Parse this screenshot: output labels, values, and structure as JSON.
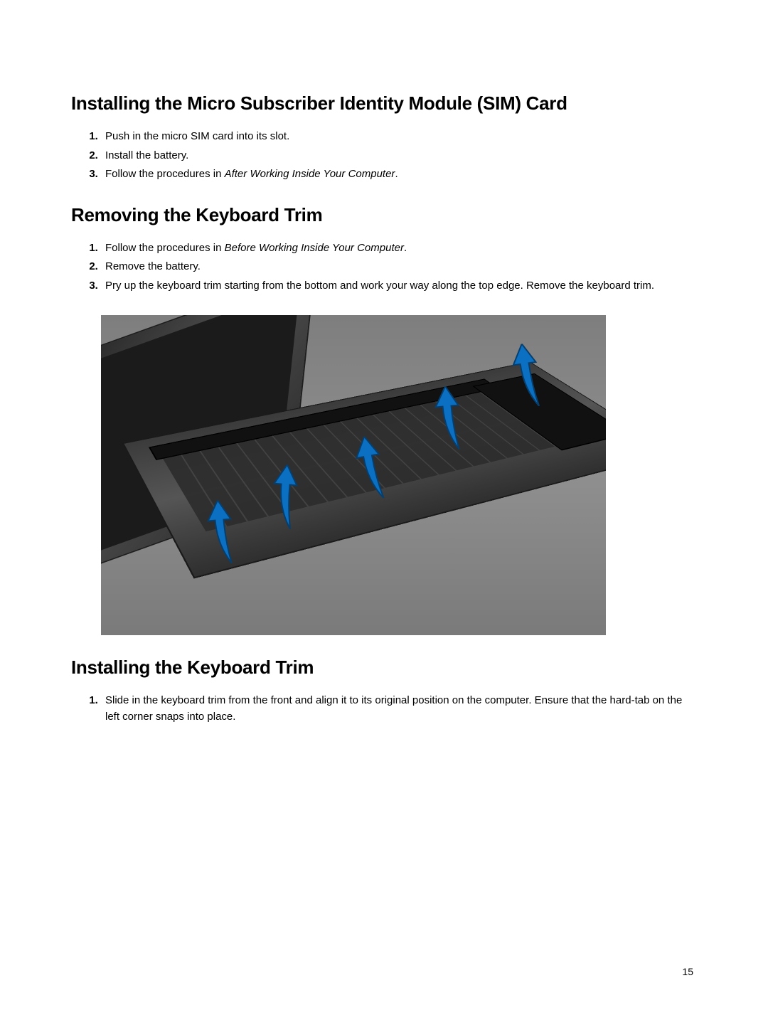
{
  "section1": {
    "heading": "Installing the Micro Subscriber Identity Module (SIM) Card",
    "steps": [
      "Push in the micro SIM card into its slot.",
      "Install the battery.",
      {
        "prefix": "Follow the procedures in ",
        "italic": "After Working Inside Your Computer",
        "suffix": "."
      }
    ]
  },
  "section2": {
    "heading": "Removing the Keyboard Trim",
    "steps": [
      {
        "prefix": "Follow the procedures in ",
        "italic": "Before Working Inside Your Computer",
        "suffix": "."
      },
      "Remove the battery.",
      "Pry up the keyboard trim starting from the bottom and work your way along the top edge. Remove the keyboard trim."
    ],
    "figure_alt": "Illustration of a laptop with blue arrows showing the keyboard trim being pried up from multiple points along its edge."
  },
  "section3": {
    "heading": "Installing the Keyboard Trim",
    "steps": [
      "Slide in the keyboard trim from the front and align it to its original position on the computer. Ensure that the hard-tab on the left corner snaps into place."
    ]
  },
  "page_number": "15",
  "colors": {
    "arrow": "#0b6fc2",
    "arrow_stroke": "#063f6e"
  }
}
